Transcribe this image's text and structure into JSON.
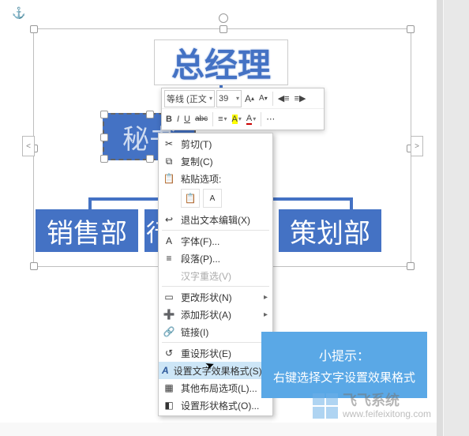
{
  "anchor_glyph": "⚓",
  "diagram": {
    "top": "总经理",
    "secretary": "秘书",
    "left": "销售部",
    "middle_partial": "行",
    "right": "策划部"
  },
  "mini_toolbar": {
    "font": "等线 (正文",
    "size": "39",
    "grow": "A▲",
    "shrink": "A▼",
    "bold": "B",
    "italic": "I",
    "underline": "U",
    "strike": "abc",
    "highlight": "A"
  },
  "context_menu": {
    "cut": "剪切(T)",
    "copy": "复制(C)",
    "paste_header": "粘贴选项:",
    "exit_text": "退出文本编辑(X)",
    "font": "字体(F)...",
    "paragraph": "段落(P)...",
    "hanzi": "汉字重选(V)",
    "change_shape": "更改形状(N)",
    "add_shape": "添加形状(A)",
    "link": "链接(I)",
    "reset_shape": "重设形状(E)",
    "text_effects": "设置文字效果格式(S)...",
    "layout_options": "其他布局选项(L)...",
    "shape_format": "设置形状格式(O)..."
  },
  "tip": {
    "title": "小提示：",
    "body": "右键选择文字设置效果格式"
  },
  "brand": {
    "name": "飞飞系统",
    "url": "www.feifeixitong.com"
  },
  "side_left": "<",
  "side_right": ">"
}
